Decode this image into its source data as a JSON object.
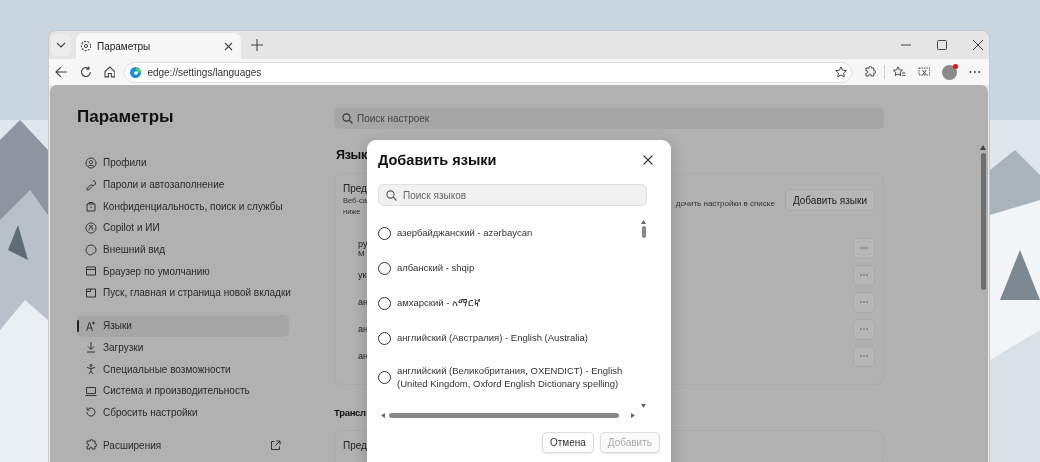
{
  "browser": {
    "tabs": [
      {
        "title": "Параметры",
        "selected": true
      }
    ],
    "address": "edge://settings/languages"
  },
  "settings": {
    "title": "Параметры",
    "search_placeholder": "Поиск настроек",
    "nav": [
      {
        "label": "Профили",
        "selected": false
      },
      {
        "label": "Пароли и автозаполнение",
        "selected": false
      },
      {
        "label": "Конфиденциальность, поиск и службы",
        "selected": false
      },
      {
        "label": "Copilot и ИИ",
        "selected": false
      },
      {
        "label": "Внешний вид",
        "selected": false
      },
      {
        "label": "Браузер по умолчанию",
        "selected": false
      },
      {
        "label": "Пуск, главная и страница новой вкладки",
        "selected": false
      },
      {
        "label": "Языки",
        "selected": true
      },
      {
        "label": "Загрузки",
        "selected": false
      },
      {
        "label": "Специальные возможности",
        "selected": false
      },
      {
        "label": "Система и производительность",
        "selected": false
      },
      {
        "label": "Сбросить настройки",
        "selected": false
      }
    ],
    "extensions": {
      "label": "Расширения"
    }
  },
  "main": {
    "heading": "Язык",
    "card": {
      "title": "Пред",
      "desc_lines": [
        "Веб-са",
        "ниже"
      ],
      "desc_tail": "дочить настройки в списке",
      "add_button": "Добавить языки",
      "languages": [
        {
          "name": "ру",
          "sub": "М"
        },
        {
          "name": "ук"
        },
        {
          "name": "ан"
        },
        {
          "name": "ан"
        },
        {
          "name": "ан"
        }
      ]
    },
    "section2": {
      "heading": "Трансл",
      "card_title": "Пред"
    }
  },
  "dialog": {
    "title": "Добавить языки",
    "search_placeholder": "Поиск языков",
    "options": [
      {
        "label": "азербайджанский - azərbaycan",
        "selected": false
      },
      {
        "label": "албанский - shqip",
        "selected": false
      },
      {
        "label": "амхарский - አማርኛ",
        "selected": false
      },
      {
        "label": "английский (Австралия) - English (Australia)",
        "selected": false
      },
      {
        "label": "английский (Великобритания, OXENDICT) - English (United Kingdom, Oxford English Dictionary spelling)",
        "selected": false
      }
    ],
    "buttons": [
      {
        "label": "Отмена",
        "disabled": false
      },
      {
        "label": "Добавить",
        "disabled": true
      }
    ]
  }
}
